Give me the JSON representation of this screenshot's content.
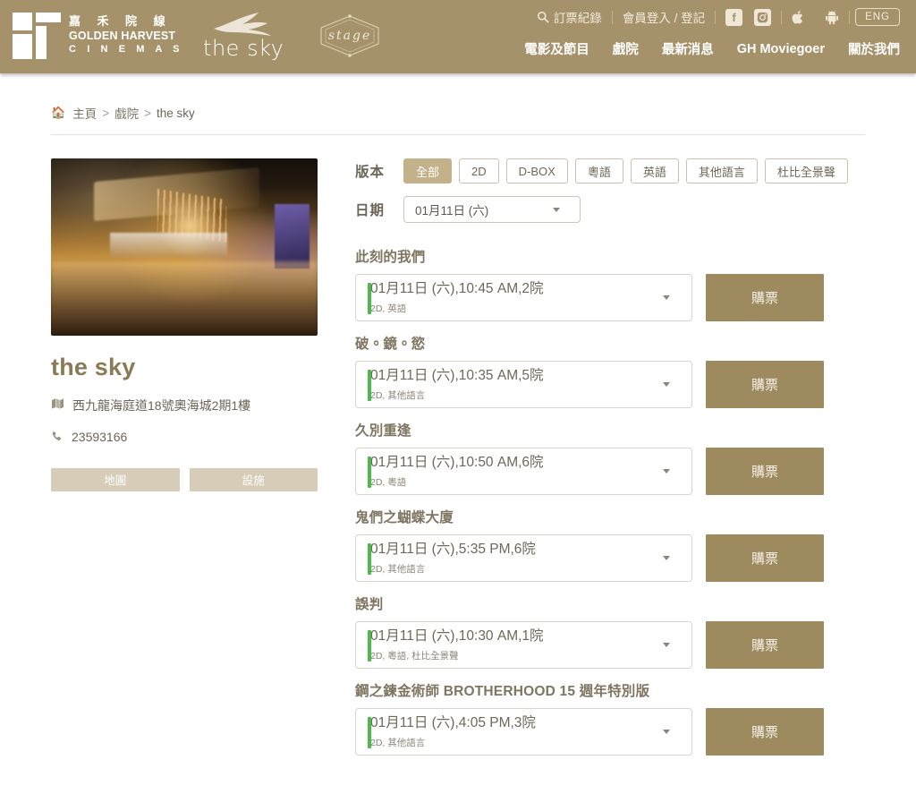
{
  "header": {
    "brand": {
      "cn_name": "嘉 禾 院 線",
      "en_name": "GOLDEN HARVEST",
      "en_sub": "C I N E M A S",
      "sky_label": "the sky",
      "stage_label": "stage"
    },
    "utility": [
      {
        "name": "booking-history",
        "icon": "search-icon",
        "label": "訂票紀錄"
      },
      {
        "name": "member-login",
        "icon": "",
        "label": "會員登入 / 登記"
      }
    ],
    "social": [
      {
        "name": "facebook-icon",
        "glyph": "f"
      },
      {
        "name": "instagram-icon",
        "glyph": "◙"
      },
      {
        "name": "apple-icon",
        "glyph": ""
      },
      {
        "name": "android-icon",
        "glyph": "✦"
      }
    ],
    "language_button": "ENG",
    "nav": [
      {
        "name": "movies-and-programmes",
        "label": "電影及節目"
      },
      {
        "name": "cinemas",
        "label": "戲院"
      },
      {
        "name": "latest-news",
        "label": "最新消息"
      },
      {
        "name": "gh-moviegoer",
        "label": "GH Moviegoer"
      },
      {
        "name": "about-us",
        "label": "關於我們"
      }
    ]
  },
  "breadcrumb": {
    "home_icon": "home-icon",
    "items": [
      "主頁",
      "戲院",
      "the sky"
    ],
    "separator": ">"
  },
  "cinema": {
    "photo_alt": "cinema-lobby-photo",
    "name": "the sky",
    "address_icon": "map-icon",
    "address": "西九龍海庭道18號奧海城2期1樓",
    "phone_icon": "phone-icon",
    "phone": "23593166",
    "buttons": [
      {
        "name": "map-button",
        "label": "地圖"
      },
      {
        "name": "facilities-button",
        "label": "設施"
      }
    ]
  },
  "filters": {
    "version_label": "版本",
    "versions": [
      {
        "label": "全部",
        "active": true
      },
      {
        "label": "2D",
        "active": false
      },
      {
        "label": "D-BOX",
        "active": false
      },
      {
        "label": "粵語",
        "active": false
      },
      {
        "label": "英語",
        "active": false
      },
      {
        "label": "其他語言",
        "active": false
      },
      {
        "label": "杜比全景聲",
        "active": false
      }
    ],
    "date_label": "日期",
    "date_value": "01月11日 (六)"
  },
  "buy_button_label": "購票",
  "listings": [
    {
      "title": "此刻的我們",
      "showtime": "01月11日 (六),10:45 AM,2院",
      "attributes": "2D, 英語"
    },
    {
      "title": "破。鏡。慾",
      "showtime": "01月11日 (六),10:35 AM,5院",
      "attributes": "2D, 其他語言"
    },
    {
      "title": "久別重逢",
      "showtime": "01月11日 (六),10:50 AM,6院",
      "attributes": "2D, 粵語"
    },
    {
      "title": "鬼們之蝴蝶大廈",
      "showtime": "01月11日 (六),5:35 PM,6院",
      "attributes": "2D, 其他語言"
    },
    {
      "title": "誤判",
      "showtime": "01月11日 (六),10:30 AM,1院",
      "attributes": "2D, 粵語, 杜比全景聲"
    },
    {
      "title": "鋼之鍊金術師 BROTHERHOOD 15 週年特別版",
      "showtime": "01月11日 (六),4:05 PM,3院",
      "attributes": "2D, 其他語言"
    }
  ],
  "colors": {
    "header_bg": "#a5926a",
    "accent_gold": "#9d8a5f",
    "chip_active": "#c3b189",
    "showtime_accent": "#4cbb4c",
    "light_button": "#d6ccb8"
  }
}
